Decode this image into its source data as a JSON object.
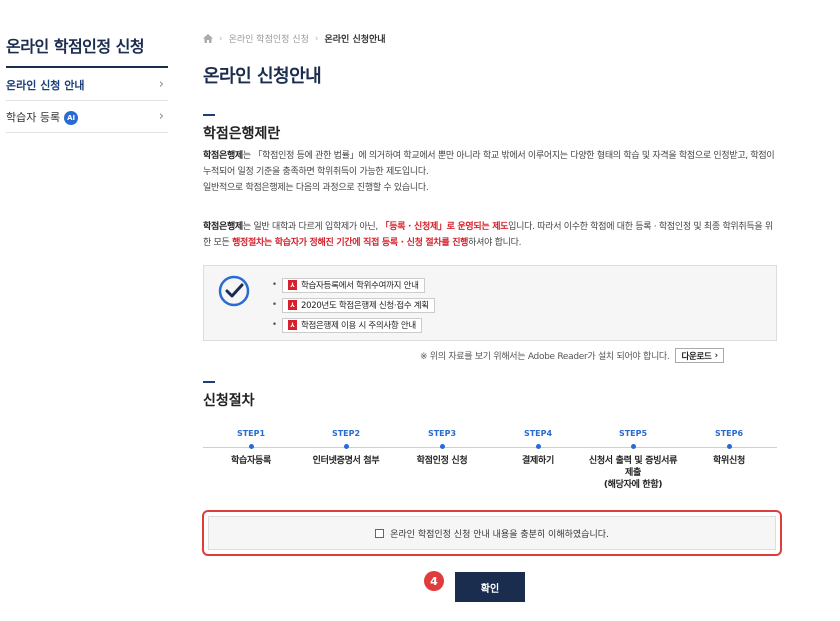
{
  "sidebar": {
    "title": "온라인 학점인정 신청",
    "items": [
      {
        "label": "온라인 신청 안내"
      },
      {
        "label": "학습자 등록",
        "badge": "AI"
      }
    ]
  },
  "breadcrumb": {
    "parent": "온라인 학점인정 신청",
    "current": "온라인 신청안내"
  },
  "page_title": "온라인 신청안내",
  "section1": {
    "title": "학점은행제란",
    "p1_term": "학점은행제",
    "p1_text": "는 「학점인정 등에 관한 법률」에 의거하여 학교에서 뿐만 아니라 학교 밖에서 이루어지는 다양한 형태의 학습 및 자격을 학점으로 인정받고, 학점이 누적되어 일정 기준을 충족하면 학위취득이 가능한 제도입니다.",
    "p1_line3": "일반적으로 학점은행제는 다음의 과정으로 진행할 수 있습니다.",
    "p2_term": "학점은행제",
    "p2_a": "는 일반 대학과 다르게 입학제가 아닌, ",
    "p2_red1": "「등록 · 신청제」로 운영되는 제도",
    "p2_b": "입니다. 따라서 이수한 학점에 대한 등록 · 학점인정 및 최종 학위취득을 위한 모든 ",
    "p2_red2": "행정절차는 학습자가 정해진 기간에 직접 등록 · 신청 절차를 진행",
    "p2_c": "하셔야 합니다."
  },
  "documents": [
    "학습자등록에서 학위수여까지 안내",
    "2020년도 학점은행제 신청·접수 계획",
    "학점은행제 이용 시 주의사항 안내"
  ],
  "adobe_note": "※ 위의 자료를 보기 위해서는 Adobe Reader가 설치 되어야 합니다.",
  "download_label": "다운로드",
  "section2": {
    "title": "신청절차",
    "steps": [
      {
        "label": "STEP1",
        "name": "학습자등록"
      },
      {
        "label": "STEP2",
        "name": "인터넷증명서 첨부"
      },
      {
        "label": "STEP3",
        "name": "학점인정 신청"
      },
      {
        "label": "STEP4",
        "name": "결제하기"
      },
      {
        "label": "STEP5",
        "name": "신청서 출력 및 증빙서류 제출\n(해당자에 한함)"
      },
      {
        "label": "STEP6",
        "name": "학위신청"
      }
    ]
  },
  "agree_text": "온라인 학점인정 신청 안내 내용을 충분히 이해하였습니다.",
  "step_badge": "4",
  "confirm_label": "확인",
  "colors": {
    "navy": "#1b2d4f",
    "accent_blue": "#2a6bd1",
    "highlight_red": "#e03c3c"
  }
}
